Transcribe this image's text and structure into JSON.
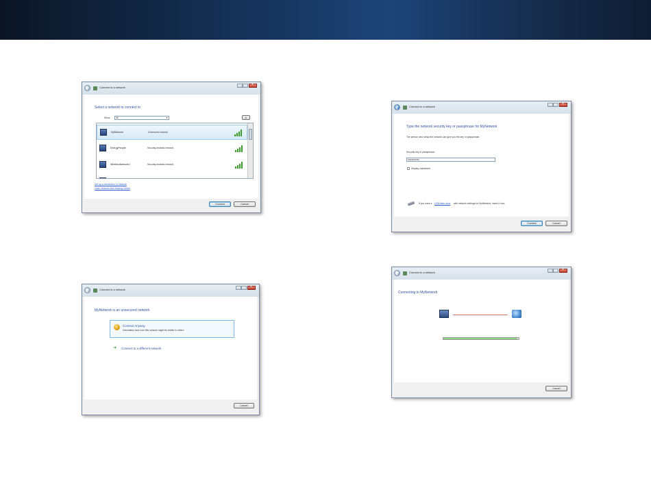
{
  "windows": {
    "select_network": {
      "title": "Connect to a network",
      "heading": "Select a network to connect to",
      "show_label": "Show",
      "show_value": "All",
      "refresh_label": "",
      "networks": [
        {
          "name": "MyNetwork",
          "security": "Unsecured network"
        },
        {
          "name": "EnergyPeople",
          "security": "Security-enabled network"
        },
        {
          "name": "WirelessNetwork1",
          "security": "Security-enabled network"
        }
      ],
      "links": [
        "Set up a connection or network",
        "Open Network and Sharing Center"
      ],
      "connect_label": "Connect",
      "cancel_label": "Cancel"
    },
    "unsecured": {
      "title": "Connect to a network",
      "heading": "MyNetwork is an unsecured network",
      "option1_title": "Connect Anyway",
      "option1_desc": "Information sent over this network might be visible to others",
      "option2_title": "Connect to a different network",
      "cancel_label": "Cancel"
    },
    "security_key": {
      "title": "Connect to a network",
      "heading": "Type the network security key or passphrase for MyNetwork",
      "subtext": "The person who setup the network can give you the key or passphrase.",
      "field_label": "Security key or passphrase:",
      "field_value": "••••••••••••",
      "checkbox_label": "Display characters",
      "usb_text_prefix": "If you have a",
      "usb_link": "USB flash drive",
      "usb_text_suffix": "with network settings for MyNetwork, insert it now.",
      "connect_label": "Connect",
      "cancel_label": "Cancel"
    },
    "connecting": {
      "title": "Connect to a network",
      "heading": "Connecting to MyNetwork",
      "progress": 0.98,
      "cancel_label": "Cancel"
    }
  }
}
